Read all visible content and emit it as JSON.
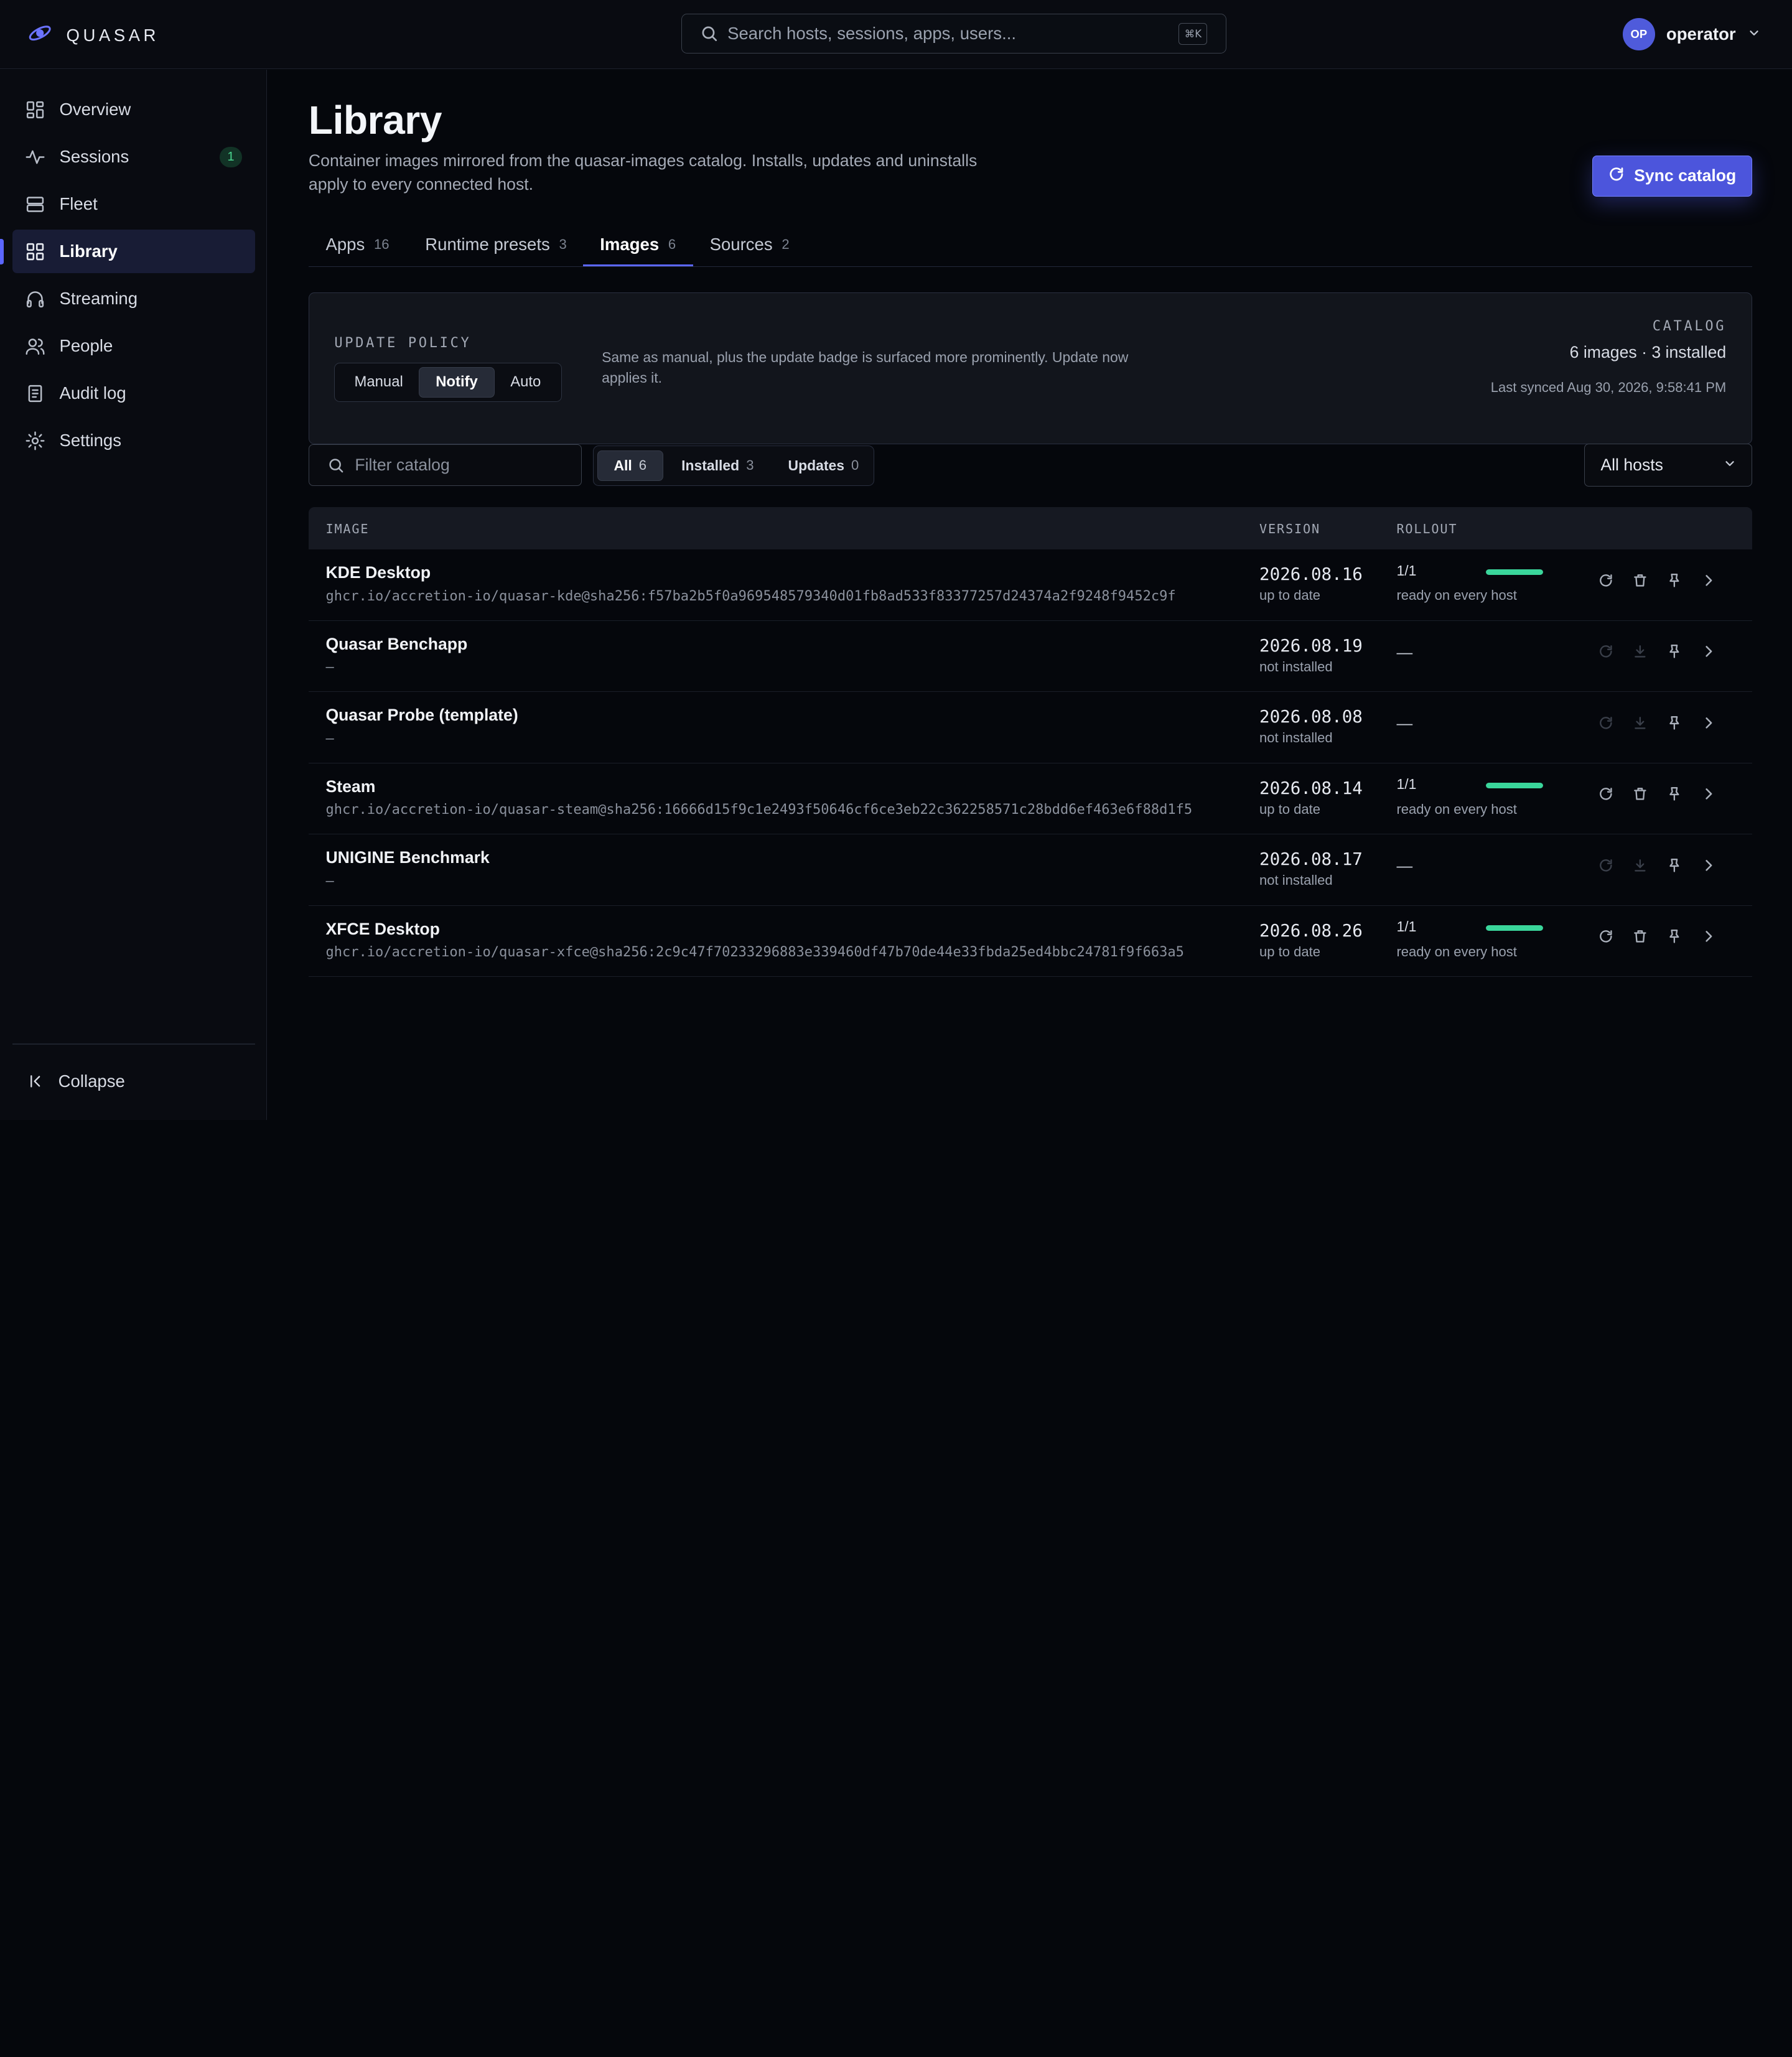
{
  "brand": {
    "name": "QUASAR"
  },
  "search": {
    "placeholder": "Search hosts, sessions, apps, users...",
    "shortcut": "⌘K"
  },
  "user": {
    "initials": "OP",
    "name": "operator"
  },
  "sidebar": {
    "items": [
      {
        "label": "Overview",
        "icon": "overview-icon"
      },
      {
        "label": "Sessions",
        "icon": "activity-icon",
        "badge": "1"
      },
      {
        "label": "Fleet",
        "icon": "server-icon"
      },
      {
        "label": "Library",
        "icon": "grid-icon",
        "active": true
      },
      {
        "label": "Streaming",
        "icon": "headphones-icon"
      },
      {
        "label": "People",
        "icon": "users-icon"
      },
      {
        "label": "Audit log",
        "icon": "document-icon"
      },
      {
        "label": "Settings",
        "icon": "gear-icon"
      }
    ],
    "collapse_label": "Collapse"
  },
  "page": {
    "title": "Library",
    "description": "Container images mirrored from the quasar-images catalog. Installs, updates and uninstalls apply to every connected host.",
    "sync_label": "Sync catalog"
  },
  "tabs": [
    {
      "label": "Apps",
      "count": "16"
    },
    {
      "label": "Runtime presets",
      "count": "3"
    },
    {
      "label": "Images",
      "count": "6",
      "active": true
    },
    {
      "label": "Sources",
      "count": "2"
    }
  ],
  "policy": {
    "label": "UPDATE POLICY",
    "options": [
      "Manual",
      "Notify",
      "Auto"
    ],
    "selected": "Notify",
    "description": "Same as manual, plus the update badge is surfaced more prominently. Update now applies it."
  },
  "catalog": {
    "label": "CATALOG",
    "summary": "6 images · 3 installed",
    "last_synced": "Last synced Aug 30, 2026, 9:58:41 PM"
  },
  "filter": {
    "placeholder": "Filter catalog"
  },
  "chips": [
    {
      "label": "All",
      "count": "6",
      "active": true
    },
    {
      "label": "Installed",
      "count": "3"
    },
    {
      "label": "Updates",
      "count": "0"
    }
  ],
  "hosts": {
    "selected": "All hosts"
  },
  "table": {
    "columns": {
      "image": "IMAGE",
      "version": "VERSION",
      "rollout": "ROLLOUT"
    },
    "rows": [
      {
        "name": "KDE Desktop",
        "ref": "ghcr.io/accretion-io/quasar-kde@sha256:f57ba2b5f0a969548579340d01fb8ad533f83377257d24374a2f9248f9452c9f",
        "version": "2026.08.16",
        "version_status": "up to date",
        "installed": true,
        "rollout_fraction": "1/1",
        "rollout_progress": 1.0,
        "rollout_note": "ready on every host"
      },
      {
        "name": "Quasar Benchapp",
        "ref": "—",
        "version": "2026.08.19",
        "version_status": "not installed",
        "installed": false,
        "rollout_dash": "—"
      },
      {
        "name": "Quasar Probe (template)",
        "ref": "—",
        "version": "2026.08.08",
        "version_status": "not installed",
        "installed": false,
        "rollout_dash": "—"
      },
      {
        "name": "Steam",
        "ref": "ghcr.io/accretion-io/quasar-steam@sha256:16666d15f9c1e2493f50646cf6ce3eb22c362258571c28bdd6ef463e6f88d1f5",
        "version": "2026.08.14",
        "version_status": "up to date",
        "installed": true,
        "rollout_fraction": "1/1",
        "rollout_progress": 1.0,
        "rollout_note": "ready on every host"
      },
      {
        "name": "UNIGINE Benchmark",
        "ref": "—",
        "version": "2026.08.17",
        "version_status": "not installed",
        "installed": false,
        "rollout_dash": "—"
      },
      {
        "name": "XFCE Desktop",
        "ref": "ghcr.io/accretion-io/quasar-xfce@sha256:2c9c47f70233296883e339460df47b70de44e33fbda25ed4bbc24781f9f663a5",
        "version": "2026.08.26",
        "version_status": "up to date",
        "installed": true,
        "rollout_fraction": "1/1",
        "rollout_progress": 1.0,
        "rollout_note": "ready on every host"
      }
    ]
  },
  "colors": {
    "accent": "#5b66ff",
    "primary_button": "#4c55dc",
    "success": "#3ad69b",
    "background": "#05070c",
    "surface": "#12151c"
  }
}
